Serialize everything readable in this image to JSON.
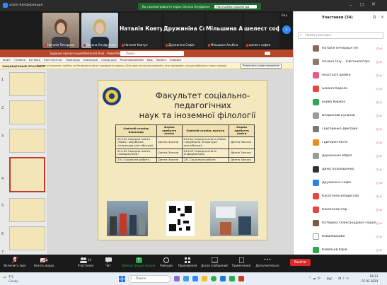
{
  "zoom": {
    "window_title": "Zoom Конференция",
    "viewing_banner": "Вы просматриваете экран Оксана Онуфрієнко",
    "view_options": "Настройки просмотра",
    "view_label": "Вид"
  },
  "gallery": {
    "tiles": [
      {
        "name": "Наталія Печериця",
        "type": "video"
      },
      {
        "name": "Оксана Онуфрієнко",
        "type": "video"
      },
      {
        "big": "Наталія Ковтун",
        "name": "Наталія Ковтун"
      },
      {
        "big": "Дружиніна Со...",
        "name": "Дружиніна Софія"
      },
      {
        "big": "Мільшина Аль...",
        "name": "Мільшина Альбіна"
      },
      {
        "big": "шелест софия",
        "name": "шелест софия"
      }
    ]
  },
  "powerpoint": {
    "file_title": "Задание презентация(Restored) final - PowerPoint",
    "search_placeholder": "Поиск",
    "tabs": [
      "Файл",
      "Главная",
      "Вставка",
      "Конструктор",
      "Переходы",
      "Анимация",
      "Слайд-шоу",
      "Рецензирование",
      "Вид",
      "Запись",
      "Справка"
    ],
    "warning_label": "ЗАЩИЩЕННЫЙ ПРОСМОТР",
    "warning_text": "Будьте осторожны: файлы из Интернета могут содержать вирусы. Если вам не нужно изменять этот документ, лучше работать с ним в режиме защищенного просмотра.",
    "enable_editing": "Разрешить редактирование",
    "thumb_numbers": [
      "1",
      "2",
      "3",
      "4",
      "5",
      "6",
      "7"
    ]
  },
  "slide": {
    "title_line1": "Факультет соціально-",
    "title_line2": "педагогічних",
    "title_line3": "наук та іноземної філології",
    "table": {
      "headers": [
        "Освітній ступінь бакалавр",
        "Форма здобуття освіти",
        "Освітній ступінь магістр",
        "Форма здобуття освіти"
      ],
      "rows": [
        [
          "014.02 Середня освіта (Мова і зарубіжна література (англійська))",
          "Денна Заочна",
          "014.02 Середня освіта (Мова і зарубіжна література (англійська))",
          "Денна Заочна"
        ],
        [
          "014.09 Середня освіта (Інформатика)",
          "Денна Заочна",
          "014.09 Середня освіта (Інформатика)",
          "Денна Заочна"
        ],
        [
          "231 Соціальна робота",
          "Денна Заочна",
          "231 Соціальна робота",
          "Денна Заочна"
        ]
      ]
    }
  },
  "participants": {
    "header": "Участники (34)",
    "search_placeholder": "Найти участника",
    "list": [
      {
        "name": "Наталія Печериця (Я)",
        "color": "#8a6a5a"
      },
      {
        "name": "Оксана Ону... (Организатор)",
        "color": "#8e7a6c"
      },
      {
        "name": "Анастасія Шейко",
        "color": "#e85c8a"
      },
      {
        "name": "Баканя Кирило",
        "color": "#e5493d"
      },
      {
        "name": "Бойко Кирило",
        "color": "#2da84b"
      },
      {
        "name": "Владислав Буланов",
        "color": "#9a9a9a"
      },
      {
        "name": "Григоренко Дмитрий",
        "color": "#7a7a7a"
      },
      {
        "name": "Григорій Нікіта",
        "color": "#f08a1c"
      },
      {
        "name": "Дорошенко Марія",
        "color": "#9a9a9a"
      },
      {
        "name": "Дима Похонаренко",
        "color": "#333333"
      },
      {
        "name": "Дружиніна Софія",
        "color": "#2f80ed"
      },
      {
        "name": "Касатонов Владислав",
        "color": "#e5493d"
      },
      {
        "name": "Касатонов Ігор",
        "color": "#e5493d"
      },
      {
        "name": "Катерина Олександрівна Подол...",
        "color": "#7a5a4a"
      },
      {
        "name": "Ковалёв/раба",
        "color": "#ffffff"
      },
      {
        "name": "Ковальов Юрій",
        "color": "#2da84b"
      }
    ],
    "invite": "Пригласить",
    "mute_all": "Выключить свой звук"
  },
  "toolbar": {
    "mute": "Включить звук",
    "video": "Начать видео",
    "participants": "Участники",
    "participants_count": "34",
    "chat": "Чат",
    "share": "Демонстрация экрана",
    "reactions": "Реакции",
    "apps": "Приложения",
    "whiteboards": "Доски сообщений",
    "notes": "Примечания",
    "more": "Дополнительно",
    "leave": "Выйти"
  },
  "taskbar": {
    "weather_temp": "7°C",
    "weather_desc": "Cloudy",
    "search": "Поиск",
    "lang": "РУС",
    "time": "18:13",
    "date": "07.02.2024"
  }
}
